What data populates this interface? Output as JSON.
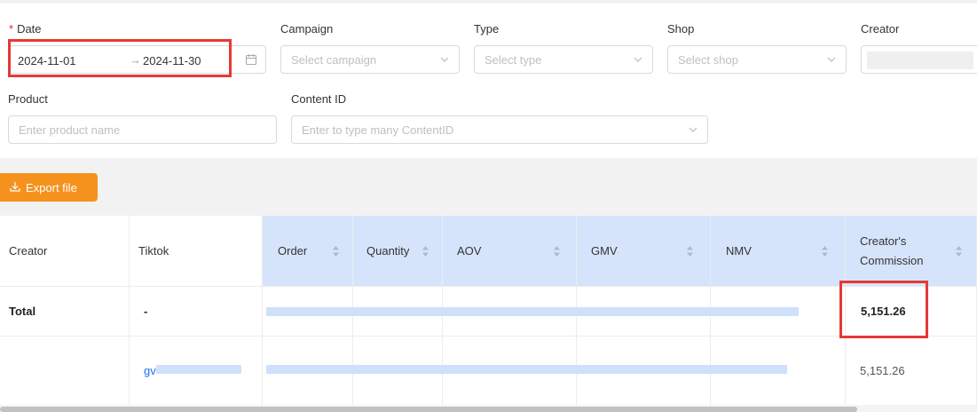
{
  "filters": {
    "date": {
      "label": "Date",
      "start": "2024-11-01",
      "arrow": "→",
      "end": "2024-11-30"
    },
    "campaign": {
      "label": "Campaign",
      "placeholder": "Select campaign"
    },
    "type": {
      "label": "Type",
      "placeholder": "Select type"
    },
    "shop": {
      "label": "Shop",
      "placeholder": "Select shop"
    },
    "creator": {
      "label": "Creator"
    },
    "product": {
      "label": "Product",
      "placeholder": "Enter product name"
    },
    "content_id": {
      "label": "Content ID",
      "placeholder": "Enter to type many ContentID"
    }
  },
  "toolbar": {
    "export_label": "Export file"
  },
  "table": {
    "columns": {
      "creator": "Creator",
      "tiktok": "Tiktok",
      "order": "Order",
      "quantity": "Quantity",
      "aov": "AOV",
      "gmv": "GMV",
      "nmv": "NMV",
      "commission_line1": "Creator's",
      "commission_line2": "Commission"
    },
    "total": {
      "creator": "Total",
      "tiktok": "-",
      "commission": "5,151.26"
    },
    "rows": [
      {
        "tiktok_prefix": "gv",
        "commission": "5,151.26"
      }
    ]
  },
  "colors": {
    "accent": "#f5921d",
    "header_blue": "#d6e4fb",
    "highlight": "#e53935",
    "required": "#f5222d"
  }
}
